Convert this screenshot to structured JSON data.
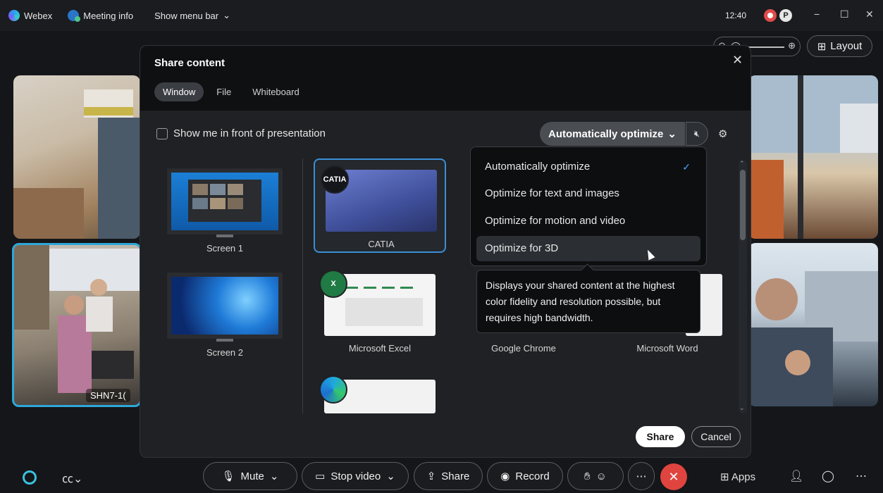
{
  "titlebar": {
    "app_name": "Webex",
    "meeting_info": "Meeting info",
    "show_menu_bar": "Show menu bar",
    "time": "12:40"
  },
  "view_controls": {
    "layout_label": "Layout"
  },
  "participant_tile": {
    "name": "SHN7-1("
  },
  "dialog": {
    "title": "Share content",
    "tabs": [
      "Window",
      "File",
      "Whiteboard"
    ],
    "active_tab": "Window",
    "checkbox_label": "Show me in front of presentation",
    "optimize_selected": "Automatically optimize",
    "screens": [
      "Screen 1",
      "Screen 2"
    ],
    "apps": [
      "CATIA",
      "Microsoft Excel",
      "Google Chrome",
      "Microsoft Word"
    ],
    "share_label": "Share",
    "cancel_label": "Cancel"
  },
  "optimize_menu": {
    "items": [
      "Automatically optimize",
      "Optimize for text and images",
      "Optimize for motion and video",
      "Optimize for 3D"
    ],
    "checked": "Automatically optimize",
    "hovered": "Optimize for 3D",
    "tooltip": "Displays your shared content at the highest color fidelity and resolution possible, but requires high bandwidth."
  },
  "toolbar": {
    "mute": "Mute",
    "stop_video": "Stop video",
    "share": "Share",
    "record": "Record",
    "apps": "Apps"
  },
  "colors": {
    "accent_blue": "#3a8fd6",
    "end_call_red": "#e0443f",
    "check_blue": "#4aa3ff"
  }
}
